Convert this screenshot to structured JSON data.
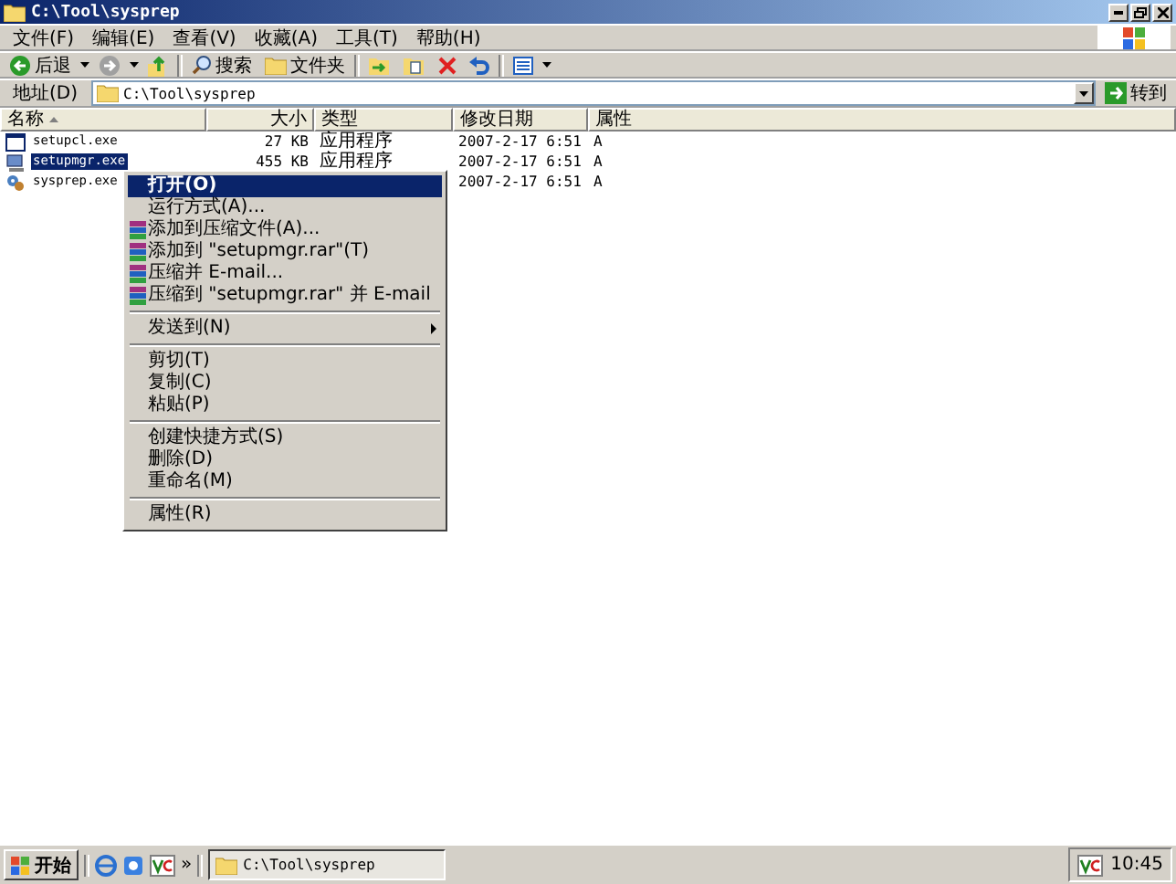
{
  "window": {
    "title": "C:\\Tool\\sysprep"
  },
  "menu_bar": [
    {
      "label": "文件(F)"
    },
    {
      "label": "编辑(E)"
    },
    {
      "label": "查看(V)"
    },
    {
      "label": "收藏(A)"
    },
    {
      "label": "工具(T)"
    },
    {
      "label": "帮助(H)"
    }
  ],
  "toolbar": {
    "back": "后退",
    "search": "搜索",
    "folders": "文件夹",
    "forward_disabled": true
  },
  "address_bar": {
    "label": "地址(D)",
    "value": "C:\\Tool\\sysprep",
    "go": "转到"
  },
  "table": {
    "columns": [
      {
        "label": "名称",
        "sorted": true
      },
      {
        "label": "大小"
      },
      {
        "label": "类型"
      },
      {
        "label": "修改日期"
      },
      {
        "label": "属性"
      }
    ],
    "rows": [
      {
        "name": "setupcl.exe",
        "size": "27 KB",
        "type": "应用程序",
        "modified": "2007-2-17 6:51",
        "attributes": "A",
        "selected": false
      },
      {
        "name": "setupmgr.exe",
        "size": "455 KB",
        "type": "应用程序",
        "modified": "2007-2-17 6:51",
        "attributes": "A",
        "selected": true
      },
      {
        "name": "sysprep.exe",
        "modified": "2007-2-17 6:51",
        "attributes": "A",
        "selected": false
      }
    ]
  },
  "context_menu": [
    {
      "kind": "item",
      "label": "打开(O)",
      "default": true,
      "selected": true
    },
    {
      "kind": "item",
      "label": "运行方式(A)...",
      "selected": false
    },
    {
      "kind": "archive",
      "label": "添加到压缩文件(A)...",
      "selected": false
    },
    {
      "kind": "archive",
      "label": "添加到 \"setupmgr.rar\"(T)",
      "selected": false
    },
    {
      "kind": "archive",
      "label": "压缩并 E-mail...",
      "selected": false
    },
    {
      "kind": "archive",
      "label": "压缩到 \"setupmgr.rar\" 并 E-mail",
      "selected": false
    },
    {
      "kind": "separator"
    },
    {
      "kind": "item",
      "label": "发送到(N)",
      "submenu": true,
      "selected": false
    },
    {
      "kind": "separator"
    },
    {
      "kind": "item",
      "label": "剪切(T)",
      "selected": false
    },
    {
      "kind": "item",
      "label": "复制(C)",
      "selected": false
    },
    {
      "kind": "item",
      "label": "粘贴(P)",
      "selected": false
    },
    {
      "kind": "separator"
    },
    {
      "kind": "item",
      "label": "创建快捷方式(S)",
      "selected": false
    },
    {
      "kind": "item",
      "label": "删除(D)",
      "selected": false
    },
    {
      "kind": "item",
      "label": "重命名(M)",
      "selected": false
    },
    {
      "kind": "separator"
    },
    {
      "kind": "item",
      "label": "属性(R)",
      "selected": false
    }
  ],
  "taskbar": {
    "start": "开始",
    "more": "»",
    "task": "C:\\Tool\\sysprep",
    "clock": "10:45"
  }
}
